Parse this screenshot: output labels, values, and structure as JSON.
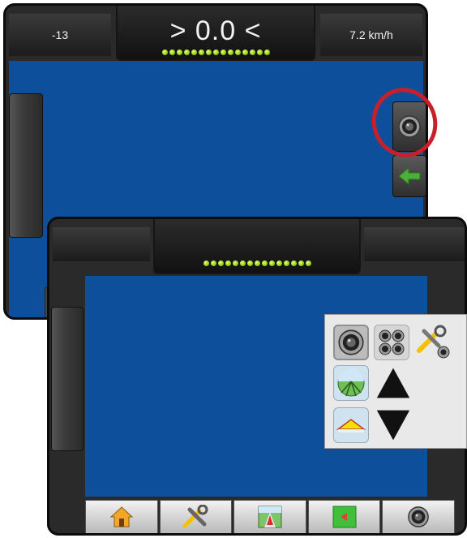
{
  "top_screen": {
    "left_value": "-13",
    "guidance_text": "> 0.0 <",
    "speed": "7.2 km/h",
    "lightbar_dots": 15
  },
  "bottom_screen": {
    "lightbar_dots": 15,
    "menu": {
      "items": [
        "camera-single-view",
        "camera-quad-view",
        "camera-settings",
        "field-view",
        "zoom-up",
        "horizon-view",
        "zoom-down"
      ]
    },
    "bottom_nav": [
      "home",
      "settings",
      "guidance",
      "field",
      "camera"
    ]
  },
  "colors": {
    "map_blue": "#0d4f9a",
    "lightbar_green": "#8ac400",
    "highlight_red": "#c8202a",
    "back_arrow_green": "#4caf3a"
  }
}
